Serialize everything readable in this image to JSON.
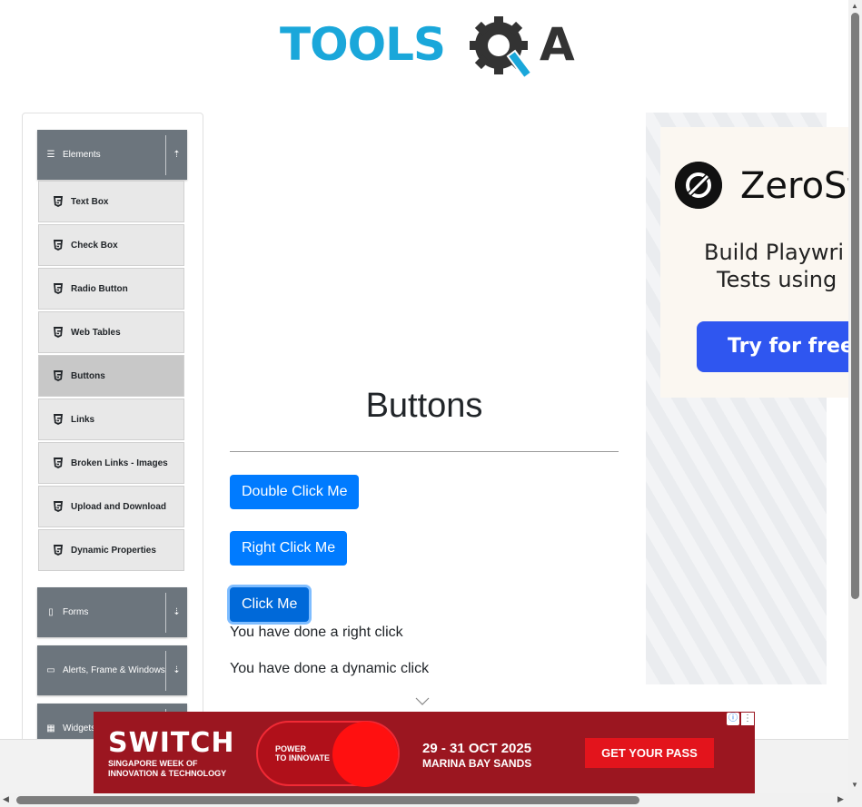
{
  "logo": {
    "text": "TOOLS",
    "suffix": "A"
  },
  "sidebar": {
    "groups": [
      {
        "label": "Elements",
        "icon": "hamburger-icon",
        "arrow": "collapse-arrow-icon"
      },
      {
        "label": "Forms",
        "icon": "form-icon",
        "arrow": "expand-arrow-icon"
      },
      {
        "label": "Alerts, Frame & Windows",
        "icon": "window-icon",
        "arrow": "expand-arrow-icon"
      },
      {
        "label": "Widgets",
        "icon": "grid-icon",
        "arrow": "expand-arrow-icon"
      }
    ],
    "items": [
      {
        "label": "Text Box"
      },
      {
        "label": "Check Box"
      },
      {
        "label": "Radio Button"
      },
      {
        "label": "Web Tables"
      },
      {
        "label": "Buttons"
      },
      {
        "label": "Links"
      },
      {
        "label": "Broken Links - Images"
      },
      {
        "label": "Upload and Download"
      },
      {
        "label": "Dynamic Properties"
      }
    ],
    "active_item": "Buttons"
  },
  "main": {
    "title": "Buttons",
    "buttons": {
      "double_click": "Double Click Me",
      "right_click": "Right Click Me",
      "click": "Click Me"
    },
    "messages": {
      "right_click": "You have done a right click",
      "dynamic_click": "You have done a dynamic click"
    }
  },
  "right_ad": {
    "brand": "ZeroSt",
    "line1": "Build Playwri",
    "line2": "Tests using",
    "cta": "Try for free -"
  },
  "banner": {
    "logo": "SWITCH",
    "subtitle_line1": "SINGAPORE WEEK OF",
    "subtitle_line2": "INNOVATION & TECHNOLOGY",
    "power_line1": "POWER",
    "power_line2": "TO INNOVATE",
    "dates": "29 - 31 OCT 2025",
    "venue": "MARINA BAY SANDS",
    "cta": "GET YOUR PASS",
    "info_icon": "ⓘ",
    "more_icon": "⋮"
  },
  "colors": {
    "primary": "#007bff",
    "logo_blue": "#1aa7da",
    "sidebar_header": "#6c757d",
    "banner_red": "#9b1620"
  }
}
